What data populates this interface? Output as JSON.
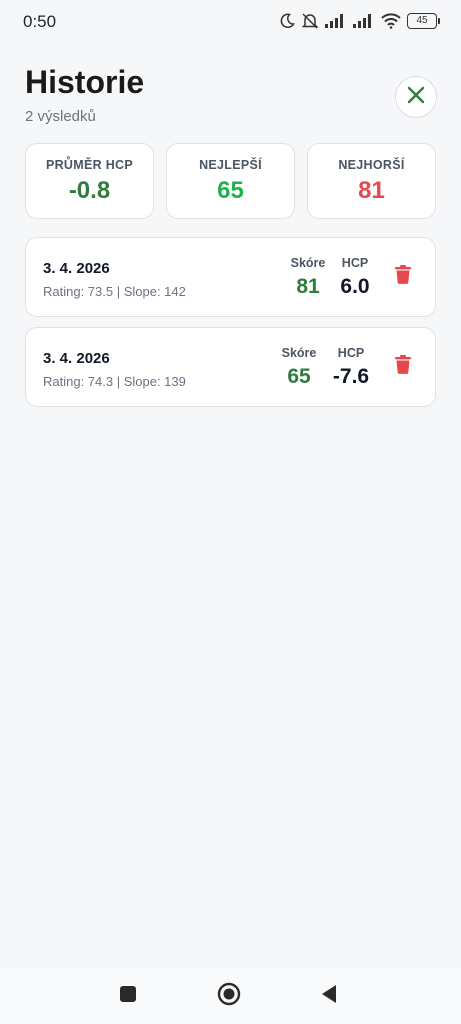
{
  "status_bar": {
    "time": "0:50",
    "battery": "45",
    "icons": [
      "moon-icon",
      "bell-muted-icon",
      "signal-icon",
      "signal-icon",
      "wifi-icon",
      "battery-icon"
    ]
  },
  "header": {
    "title": "Historie",
    "subtitle": "2 výsledků",
    "close_icon": "close-icon"
  },
  "stats": [
    {
      "label": "PRŮMĚR HCP",
      "value": "-0.8",
      "color": "#2e7d3e"
    },
    {
      "label": "NEJLEPŠÍ",
      "value": "65",
      "color": "#22b24c"
    },
    {
      "label": "NEJHORŠÍ",
      "value": "81",
      "color": "#e5484d"
    }
  ],
  "columns": {
    "score_label": "Skóre",
    "hcp_label": "HCP"
  },
  "entries": [
    {
      "date": "3. 4. 2026",
      "meta": "Rating: 73.5 | Slope: 142",
      "score": "81",
      "hcp": "6.0"
    },
    {
      "date": "3. 4. 2026",
      "meta": "Rating: 74.3 | Slope: 139",
      "score": "65",
      "hcp": "-7.6"
    }
  ],
  "colors": {
    "accent_green": "#2e7d3e",
    "delete_red": "#e5484d"
  },
  "nav": [
    "recent-apps-icon",
    "home-icon",
    "back-icon"
  ]
}
